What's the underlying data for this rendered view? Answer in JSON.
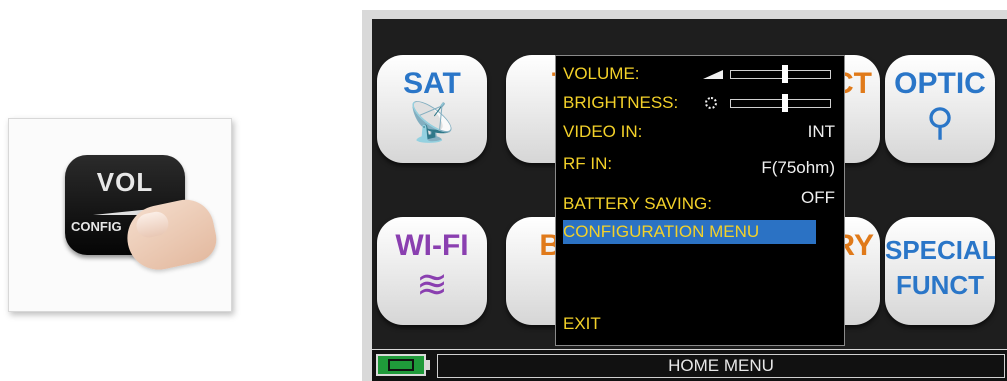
{
  "photo": {
    "key_label": "VOL",
    "key_sublabel": "CONFIG"
  },
  "tiles": {
    "sat": "SAT",
    "optic": "OPTIC",
    "wifi": "WI-FI",
    "special_line1": "SPECIAL",
    "special_line2": "FUNCT",
    "partial_t": "T",
    "partial_ct": "CT",
    "partial_ba": "BA",
    "partial_ory": "ORY"
  },
  "menu": {
    "volume_label": "VOLUME:",
    "brightness_label": "BRIGHTNESS:",
    "video_in_label": "VIDEO IN:",
    "video_in_value": "INT",
    "rf_in_label": "RF IN:",
    "rf_in_value": "F(75ohm)",
    "battery_saving_label": "BATTERY SAVING:",
    "battery_saving_value": "OFF",
    "configuration_label": "CONFIGURATION MENU",
    "exit_label": "EXIT",
    "volume_level": 0.55,
    "brightness_level": 0.55
  },
  "status_bar": {
    "title": "HOME MENU"
  },
  "colors": {
    "menu_text": "#f3d129",
    "selection": "#2b72c4",
    "battery": "#1f9a3a"
  }
}
